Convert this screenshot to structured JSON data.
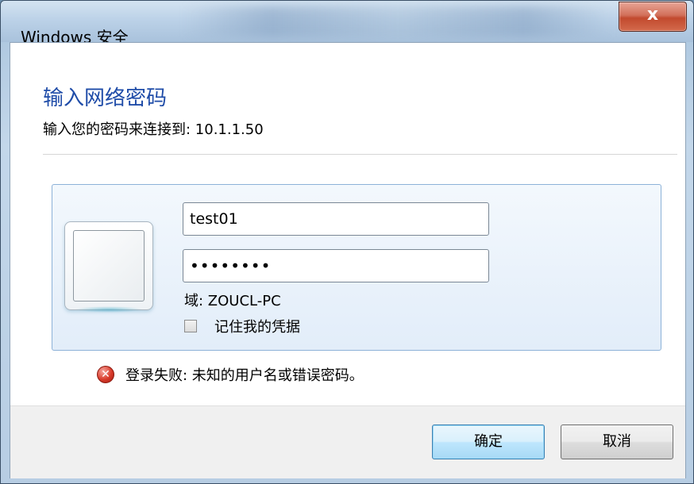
{
  "window": {
    "title": "Windows 安全",
    "close_label": "x"
  },
  "dialog": {
    "heading": "输入网络密码",
    "subheading": "输入您的密码来连接到: 10.1.1.50"
  },
  "credentials": {
    "username_value": "test01",
    "password_value": "••••••••",
    "domain_text": "域: ZOUCL-PC",
    "remember_label": "记住我的凭据",
    "remember_checked": false
  },
  "error": {
    "message": "登录失败: 未知的用户名或错误密码。",
    "icon": "error-x-icon"
  },
  "buttons": {
    "ok_label": "确定",
    "cancel_label": "取消"
  },
  "colors": {
    "heading": "#1f4ca8",
    "panel_border": "#8db2d8",
    "close_button": "#c24a2e"
  }
}
